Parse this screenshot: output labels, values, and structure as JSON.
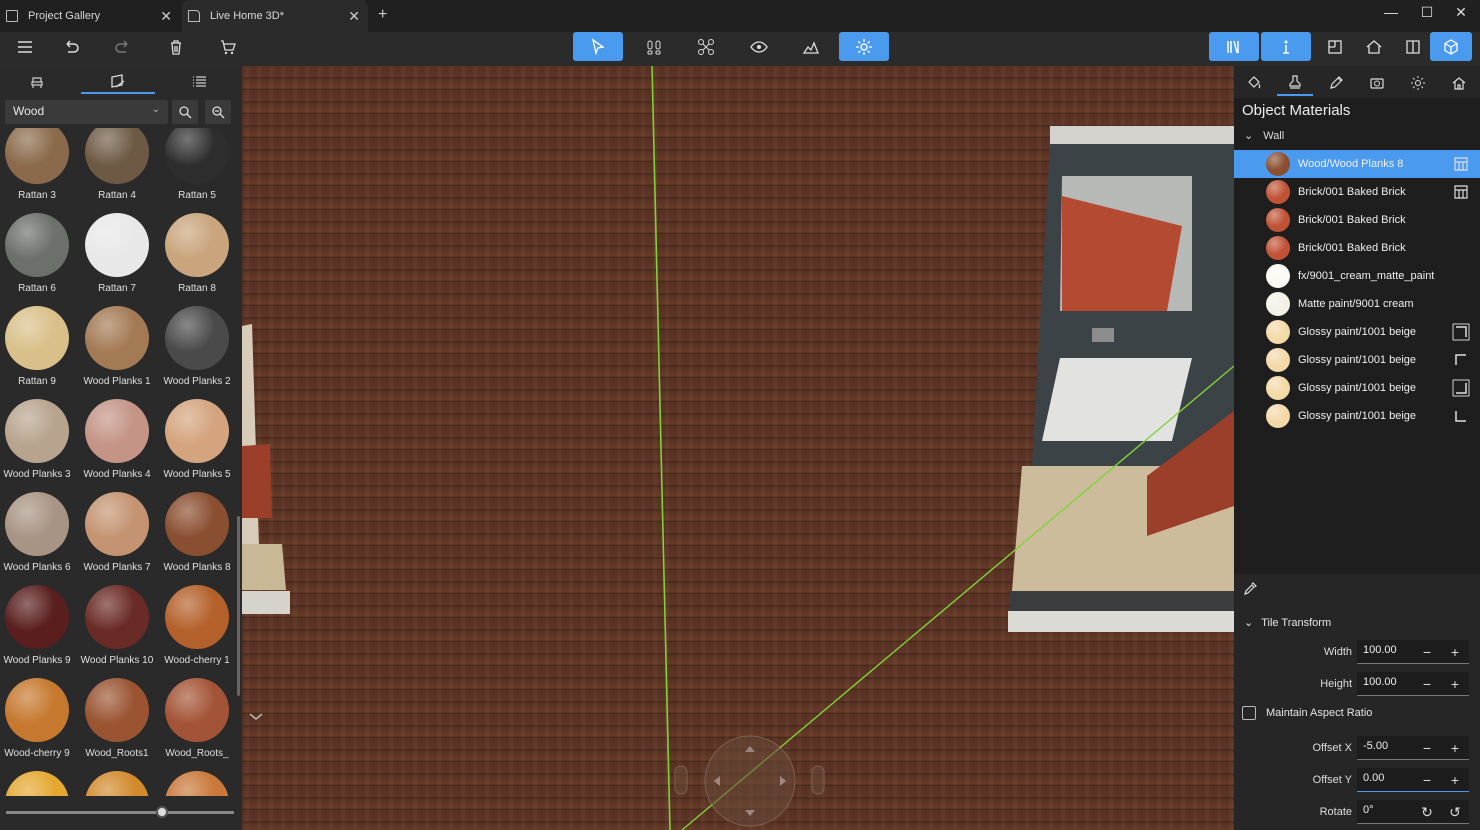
{
  "tabs": [
    {
      "label": "Project Gallery"
    },
    {
      "label": "Live Home 3D*"
    }
  ],
  "library": {
    "category": "Wood",
    "materials": [
      {
        "name": "Rattan 3",
        "color": "#8a6a4a"
      },
      {
        "name": "Rattan 4",
        "color": "#6e5a44"
      },
      {
        "name": "Rattan 5",
        "color": "#2d2d2d"
      },
      {
        "name": "Rattan 6",
        "color": "#6b706a"
      },
      {
        "name": "Rattan 7",
        "color": "#e8e8e8"
      },
      {
        "name": "Rattan 8",
        "color": "#c9a47c"
      },
      {
        "name": "Rattan 9",
        "color": "#d9c08a"
      },
      {
        "name": "Wood Planks 1",
        "color": "#a47a55"
      },
      {
        "name": "Wood Planks 2",
        "color": "#4a4a4a"
      },
      {
        "name": "Wood Planks 3",
        "color": "#b8a48e"
      },
      {
        "name": "Wood Planks 4",
        "color": "#c49486"
      },
      {
        "name": "Wood Planks 5",
        "color": "#d4a47e"
      },
      {
        "name": "Wood Planks 6",
        "color": "#a89484"
      },
      {
        "name": "Wood Planks 7",
        "color": "#c49472"
      },
      {
        "name": "Wood Planks 8",
        "color": "#8a4e30"
      },
      {
        "name": "Wood Planks 9",
        "color": "#5a1e1e"
      },
      {
        "name": "Wood Planks 10",
        "color": "#6a2a26"
      },
      {
        "name": "Wood-cherry 1",
        "color": "#b4602a"
      },
      {
        "name": "Wood-cherry 9",
        "color": "#c6782e"
      },
      {
        "name": "Wood_Roots1",
        "color": "#9a5432"
      },
      {
        "name": "Wood_Roots_",
        "color": "#a45436"
      },
      {
        "name": "",
        "color": "#e4a832"
      },
      {
        "name": "",
        "color": "#d28a2e"
      },
      {
        "name": "",
        "color": "#c8783a"
      }
    ]
  },
  "inspector": {
    "title": "Object Materials",
    "section": "Wall",
    "materials": [
      {
        "name": "Wood/Wood Planks 8",
        "color": "#8a4e30",
        "selected": true,
        "icon": "material-map-icon"
      },
      {
        "name": "Brick/001 Baked Brick",
        "color": "#c05236",
        "selected": false,
        "icon": "material-map-icon"
      },
      {
        "name": "Brick/001 Baked Brick",
        "color": "#c05236",
        "selected": false,
        "icon": ""
      },
      {
        "name": "Brick/001 Baked Brick",
        "color": "#c05236",
        "selected": false,
        "icon": ""
      },
      {
        "name": "fx/9001_cream_matte_paint",
        "color": "#fbfaf4",
        "selected": false,
        "icon": ""
      },
      {
        "name": "Matte paint/9001 cream",
        "color": "#f3f1e6",
        "selected": false,
        "icon": ""
      },
      {
        "name": "Glossy paint/1001 beige",
        "color": "#f2d9a8",
        "selected": false,
        "icon": "corner-top-right-icon"
      },
      {
        "name": "Glossy paint/1001 beige",
        "color": "#f2d9a8",
        "selected": false,
        "icon": "corner-top-left-icon"
      },
      {
        "name": "Glossy paint/1001 beige",
        "color": "#f2d9a8",
        "selected": false,
        "icon": "corner-bottom-right-icon"
      },
      {
        "name": "Glossy paint/1001 beige",
        "color": "#f2d9a8",
        "selected": false,
        "icon": "corner-bottom-left-icon"
      }
    ],
    "tile_transform": {
      "header": "Tile Transform",
      "width_label": "Width",
      "width": "100.00",
      "height_label": "Height",
      "height": "100.00",
      "aspect_label": "Maintain Aspect Ratio",
      "aspect_checked": false,
      "offset_x_label": "Offset X",
      "offset_x": "-5.00",
      "offset_y_label": "Offset Y",
      "offset_y": "0.00",
      "rotate_label": "Rotate",
      "rotate": "0°"
    }
  },
  "colors": {
    "accent": "#4a9bf0",
    "panel": "#2a2a2a",
    "floor": "#5a3221",
    "grid_line": "#7fd23a"
  }
}
